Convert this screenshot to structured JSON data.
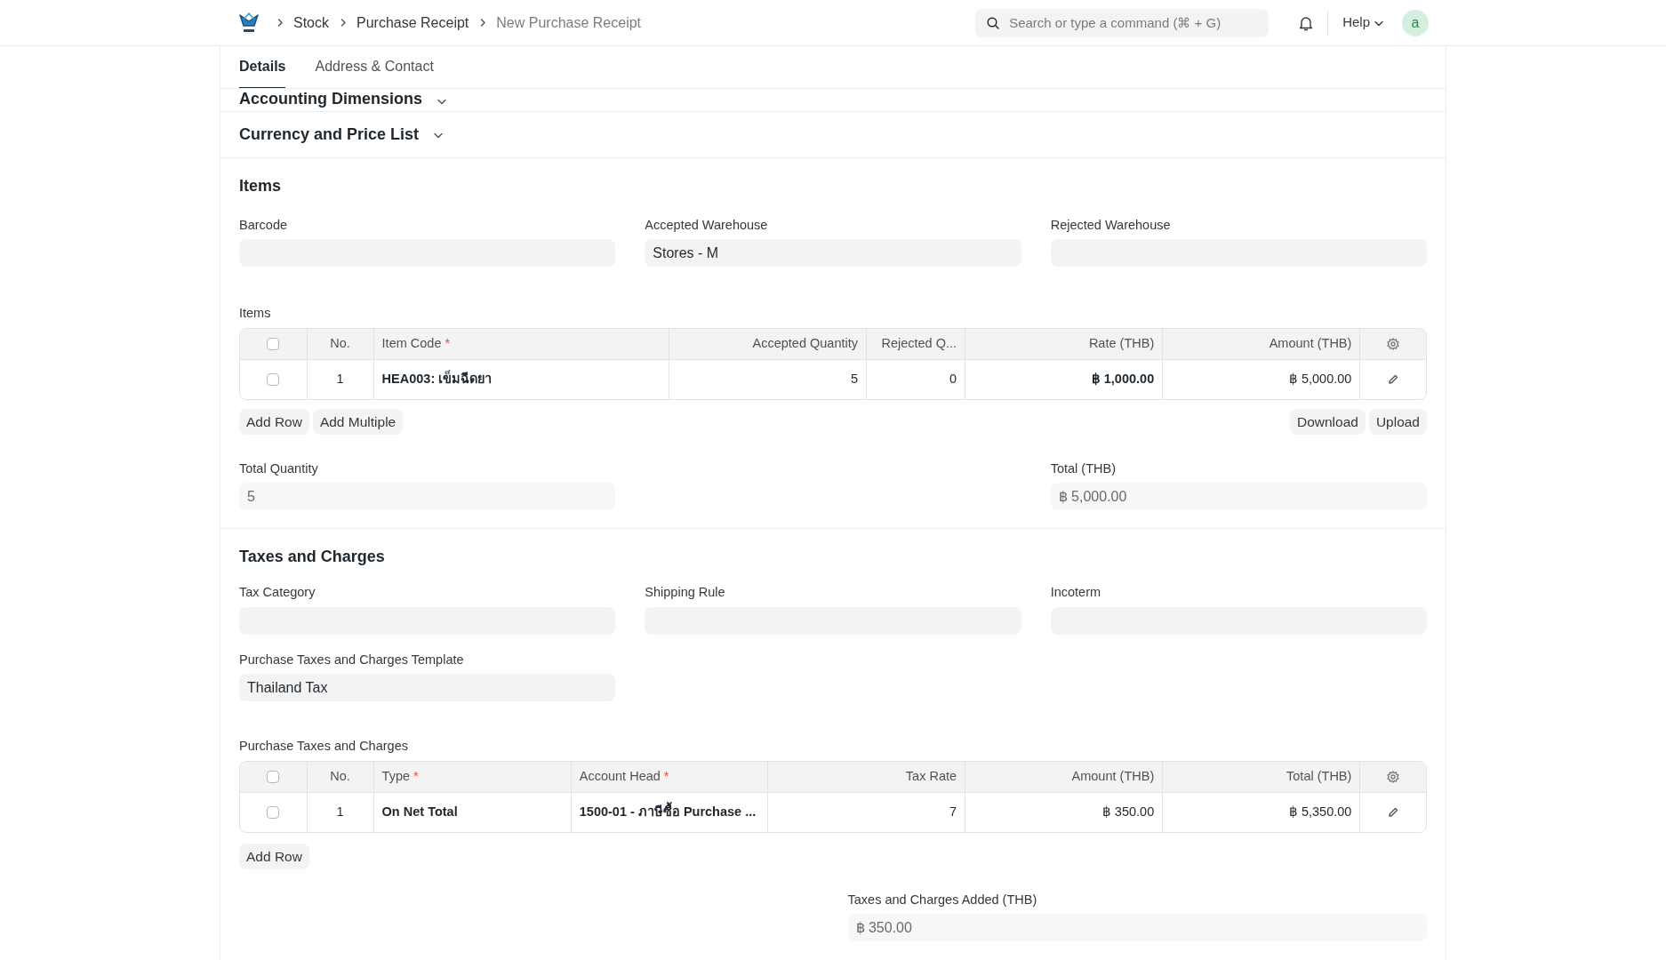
{
  "topbar": {
    "breadcrumbs": [
      {
        "label": "Stock",
        "current": false
      },
      {
        "label": "Purchase Receipt",
        "current": false
      },
      {
        "label": "New Purchase Receipt",
        "current": true
      }
    ],
    "search": {
      "placeholder": "Search or type a command (⌘ + G)"
    },
    "help": "Help",
    "avatar": "a"
  },
  "tabs": [
    {
      "label": "Details",
      "selected": true
    },
    {
      "label": "Address & Contact",
      "selected": false
    }
  ],
  "collapsed_sections": [
    "Accounting Dimensions",
    "Currency and Price List"
  ],
  "items_section": {
    "title": "Items",
    "fields": [
      {
        "label": "Barcode"
      },
      {
        "label": "Accepted Warehouse",
        "value": "Stores - M"
      },
      {
        "label": "Rejected Warehouse"
      }
    ],
    "table": {
      "label": "Items",
      "all_checked": false,
      "required_mark": "*",
      "columns": [
        {
          "label": "No.",
          "kind": "center"
        },
        {
          "label": "Item Code",
          "required": true,
          "kind": "bold_text"
        },
        {
          "label": "Accepted Quantity",
          "kind": "number"
        },
        {
          "label": "Rejected Q...",
          "kind": "number"
        },
        {
          "label": "Rate (THB)",
          "kind": "bold_number"
        },
        {
          "label": "Amount (THB)",
          "kind": "number"
        }
      ],
      "rows": [
        {
          "checked": false,
          "cells": [
            "1",
            "HEA003: เข็มฉีดยา",
            "5",
            "0",
            "฿ 1,000.00",
            "฿ 5,000.00"
          ]
        }
      ]
    },
    "left_buttons": [
      "Add Row",
      "Add Multiple"
    ],
    "right_buttons": [
      "Download",
      "Upload"
    ],
    "totals": [
      {
        "label": "Total Quantity",
        "value": "5",
        "read_only": true
      },
      {
        "label": "Total (THB)",
        "value": "฿ 5,000.00",
        "read_only": true
      }
    ]
  },
  "taxes_section": {
    "title": "Taxes and Charges",
    "fields": [
      {
        "label": "Tax Category"
      },
      {
        "label": "Shipping Rule"
      },
      {
        "label": "Incoterm"
      }
    ],
    "template": {
      "label": "Purchase Taxes and Charges Template",
      "value": "Thailand Tax"
    },
    "table": {
      "label": "Purchase Taxes and Charges",
      "all_checked": false,
      "required_mark": "*",
      "columns": [
        {
          "label": "No.",
          "kind": "center"
        },
        {
          "label": "Type",
          "required": true,
          "kind": "bold_text"
        },
        {
          "label": "Account Head",
          "required": true,
          "kind": "bold_text"
        },
        {
          "label": "Tax Rate",
          "kind": "number"
        },
        {
          "label": "Amount (THB)",
          "kind": "number"
        },
        {
          "label": "Total (THB)",
          "kind": "number"
        }
      ],
      "rows": [
        {
          "checked": false,
          "cells": [
            "1",
            "On Net Total",
            "1500-01 - ภาษีซื้อ Purchase ...",
            "7",
            "฿ 350.00",
            "฿ 5,350.00"
          ]
        }
      ]
    },
    "left_buttons": [
      "Add Row"
    ],
    "added": {
      "label": "Taxes and Charges Added (THB)",
      "value": "฿ 350.00",
      "read_only": true
    }
  }
}
